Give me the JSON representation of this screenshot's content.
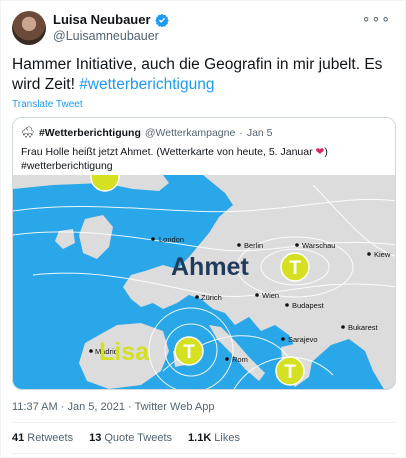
{
  "author": {
    "name": "Luisa Neubauer",
    "handle": "@Luisamneubauer"
  },
  "icons": {
    "verified": "verified-badge-icon",
    "more": "more-icon",
    "avatar": "avatar-photo"
  },
  "tweet": {
    "text_plain": "Hammer Initiative, auch die Geografin in mir jubelt. Es wird Zeit! ",
    "hashtag": "#wetterberichtigung",
    "translate_label": "Translate Tweet"
  },
  "quoted": {
    "icon": "cloud-snow-icon",
    "name": "#Wetterberichtigung",
    "handle": "@Wetterkampagne",
    "separator": "·",
    "date": "Jan 5",
    "text_before": "Frau Holle heißt jetzt Ahmet. (Wetterkarte von heute, 5. Januar ",
    "text_after": ")",
    "hashtag": "#wetterberichtigung",
    "map": {
      "cities": [
        "London",
        "Berlin",
        "Warschau",
        "Kiew",
        "Zürich",
        "Wien",
        "Budapest",
        "Bukarest",
        "Sarajevo",
        "Madrid",
        "Rom"
      ],
      "pressure_names": [
        "Ahmet",
        "Lisa"
      ],
      "pressure_symbol": "T",
      "colors": {
        "sea": "#2aa7e8",
        "land": "#dcdcdc",
        "accent": "#d4e021",
        "name_dark": "#1f3a5a"
      }
    }
  },
  "meta": {
    "time": "11:37 AM",
    "dot": "·",
    "date": "Jan 5, 2021",
    "source": "Twitter Web App"
  },
  "stats": [
    {
      "count": "41",
      "label": "Retweets"
    },
    {
      "count": "13",
      "label": "Quote Tweets"
    },
    {
      "count": "1.1K",
      "label": "Likes"
    }
  ]
}
